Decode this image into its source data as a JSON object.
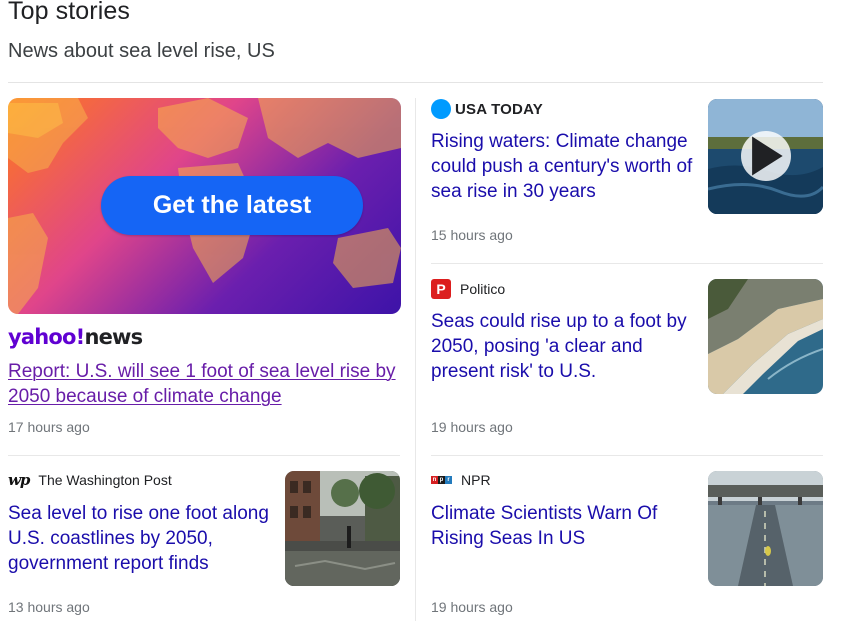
{
  "header": {
    "title": "Top stories",
    "subtitle": "News about sea level rise, US"
  },
  "colors": {
    "link": "#1a0dab",
    "visited_link": "#681da8",
    "timestamp": "#70757a",
    "hero_button": "#1565f5",
    "yahoo_purple": "#6001d2",
    "usa_today_blue": "#009bff",
    "politico_red": "#dc1e1e"
  },
  "stories": {
    "yahoo": {
      "hero_button_text": "Get the latest",
      "logo_prefix": "yahoo!",
      "logo_suffix": "news",
      "headline": "Report: U.S. will see 1 foot of sea level rise by 2050 because of climate change",
      "time": "17 hours ago",
      "icon": "yahoo-news-logo"
    },
    "usatoday": {
      "source": "USA TODAY",
      "headline": "Rising waters: Climate change could push a century's worth of sea rise in 30 years",
      "time": "15 hours ago",
      "icon": "play-icon"
    },
    "politico": {
      "icon_letter": "P",
      "source": "Politico",
      "headline": "Seas could rise up to a foot by 2050, posing 'a clear and present risk' to U.S.",
      "time": "19 hours ago"
    },
    "wapo": {
      "icon_text": "wp",
      "source": "The Washington Post",
      "headline": "Sea level to rise one foot along U.S. coastlines by 2050, government report finds",
      "time": "13 hours ago"
    },
    "npr": {
      "icon_letters": [
        "n",
        "p",
        "r"
      ],
      "source": "NPR",
      "headline": "Climate Scientists Warn Of Rising Seas In US",
      "time": "19 hours ago"
    }
  }
}
